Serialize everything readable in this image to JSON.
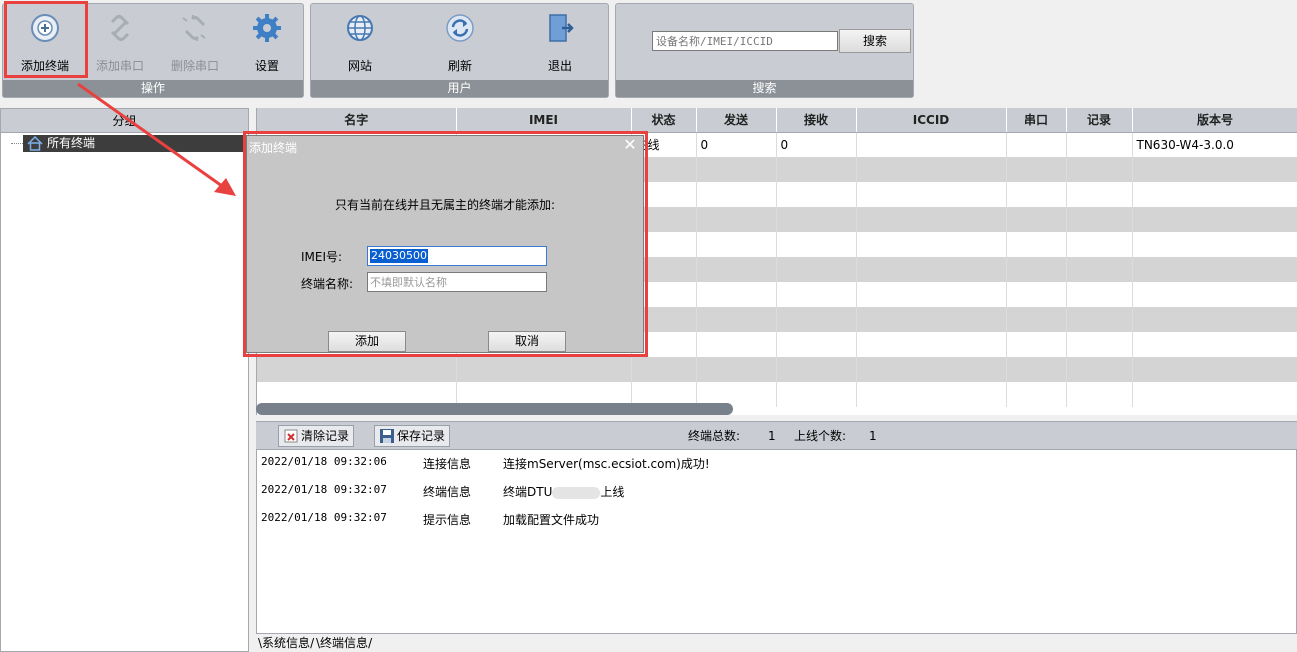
{
  "ribbon": {
    "groups": [
      {
        "footer": "操作",
        "buttons": [
          {
            "label": "添加终端",
            "icon": "add-terminal-icon",
            "enabled": true
          },
          {
            "label": "添加串口",
            "icon": "link-icon",
            "enabled": false
          },
          {
            "label": "删除串口",
            "icon": "unlink-icon",
            "enabled": false
          },
          {
            "label": "设置",
            "icon": "gear-icon",
            "enabled": true
          }
        ]
      },
      {
        "footer": "用户",
        "buttons": [
          {
            "label": "网站",
            "icon": "globe-icon",
            "enabled": true
          },
          {
            "label": "刷新",
            "icon": "refresh-icon",
            "enabled": true
          },
          {
            "label": "退出",
            "icon": "exit-icon",
            "enabled": true
          }
        ]
      },
      {
        "footer": "搜索"
      }
    ],
    "search": {
      "placeholder": "设备名称/IMEI/ICCID",
      "button": "搜索"
    }
  },
  "tree": {
    "header": "分组",
    "root": "所有终端"
  },
  "table": {
    "columns": [
      "名字",
      "IMEI",
      "状态",
      "发送",
      "接收",
      "ICCID",
      "串口",
      "记录",
      "版本号"
    ],
    "rows": [
      {
        "name": "",
        "imei": "",
        "status": "在线",
        "sent": "0",
        "recv": "0",
        "iccid": "",
        "port": "",
        "record": "",
        "version": "TN630-W4-3.0.0"
      }
    ]
  },
  "log": {
    "clear_label": "清除记录",
    "save_label": "保存记录",
    "total_label": "终端总数:",
    "total_value": "1",
    "online_label": "上线个数:",
    "online_value": "1",
    "entries": [
      {
        "time": "2022/01/18 09:32:06",
        "type": "连接信息",
        "msg": "连接mServer(msc.ecsiot.com)成功!"
      },
      {
        "time": "2022/01/18 09:32:07",
        "type": "终端信息",
        "msg_prefix": "终端DTU",
        "msg_suffix": "上线"
      },
      {
        "time": "2022/01/18 09:32:07",
        "type": "提示信息",
        "msg": "加载配置文件成功"
      }
    ],
    "tabs": [
      "系统信息",
      "终端信息"
    ]
  },
  "dialog": {
    "title": "添加终端",
    "message": "只有当前在线并且无属主的终端才能添加:",
    "imei_label": "IMEI号:",
    "imei_value": "24030500",
    "name_label": "终端名称:",
    "name_placeholder": "不填即默认名称",
    "add_label": "添加",
    "cancel_label": "取消"
  },
  "colors": {
    "annotation": "#e8413f",
    "ribbon": "#c9cdd3",
    "group_footer": "#8c9198",
    "selection": "#0a5fd0"
  }
}
